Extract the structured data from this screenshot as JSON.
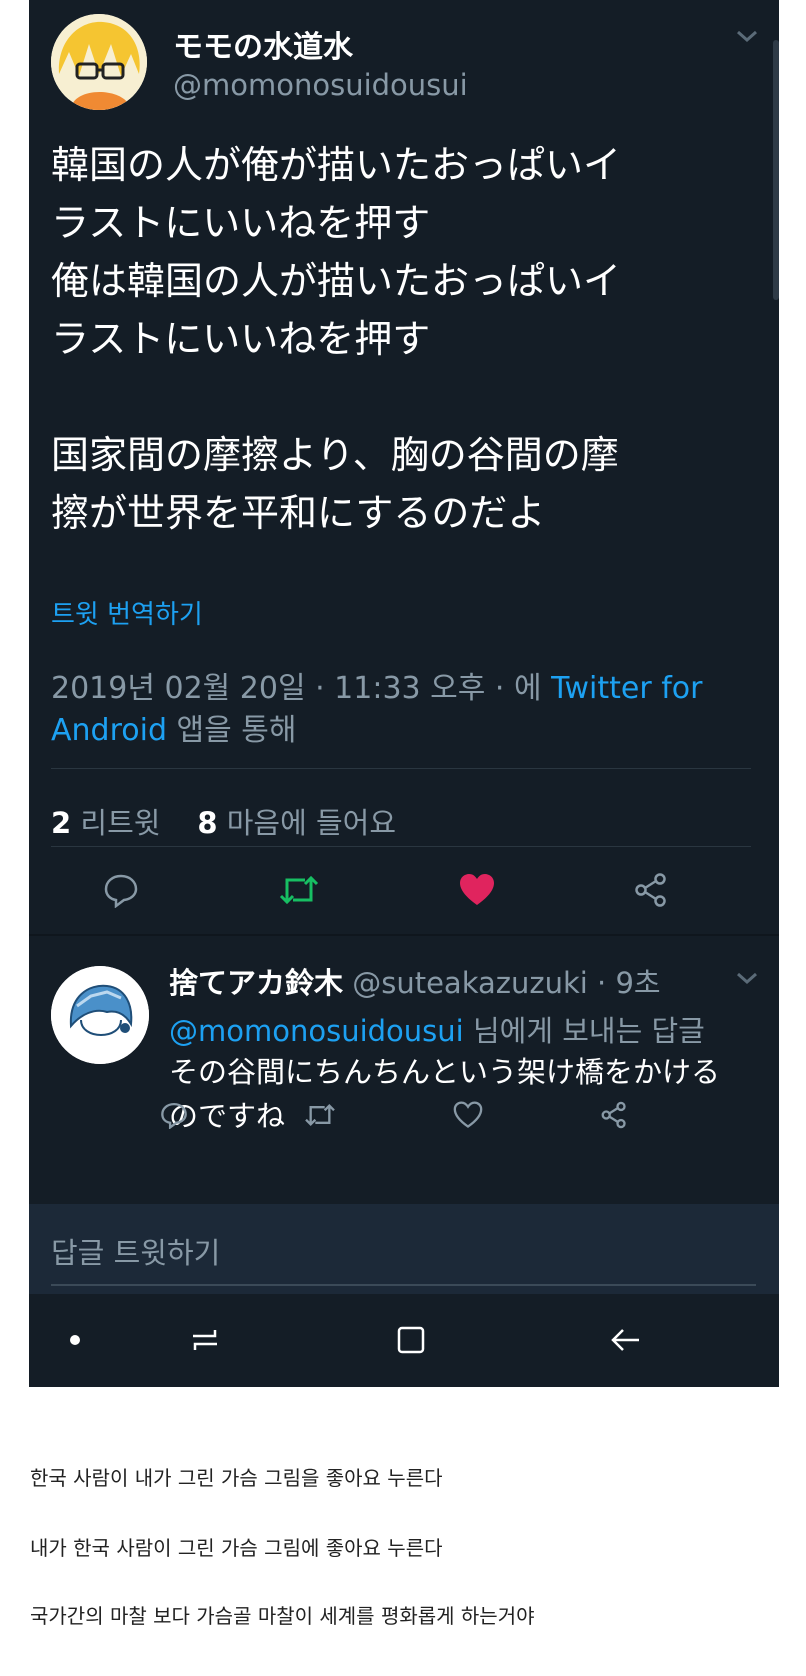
{
  "tweet": {
    "display_name": "モモの水道水",
    "handle": "@momonosuidousui",
    "text": "韓国の人が俺が描いたおっぱいイ\nラストにいいねを押す\n俺は韓国の人が描いたおっぱいイ\nラストにいいねを押す\n\n国家間の摩擦より、胸の谷間の摩\n擦が世界を平和にするのだよ",
    "translate_label": "트윗 번역하기",
    "meta_date": "2019년 02월 20일 · 11:33 오후 · 에 ",
    "meta_source": "Twitter for Android",
    "meta_suffix": " 앱을 통해",
    "retweet_count": "2",
    "retweet_label": " 리트윗",
    "like_count": "8",
    "like_label": " 마음에 들어요"
  },
  "reply": {
    "display_name": "捨てアカ鈴木",
    "handle_time": " @suteakazuzuki · 9초",
    "mention": "@momonosuidousui",
    "to_suffix": " 님에게 보내는 답글",
    "text": "その谷間にちんちんという架け橋をかける\nのですね"
  },
  "compose": {
    "placeholder": "답글 트윗하기"
  },
  "korean_lines": [
    "한국 사람이 내가 그린 가슴 그림을 좋아요 누른다",
    "내가 한국 사람이 그린 가슴 그림에 좋아요 누른다",
    "국가간의 마찰 보다 가슴골 마찰이 세계를 평화롭게 하는거야"
  ],
  "colors": {
    "background": "#141d26",
    "accent": "#1da1f2",
    "retweet": "#17bf63",
    "like": "#e0245e",
    "muted": "#8899a6"
  }
}
